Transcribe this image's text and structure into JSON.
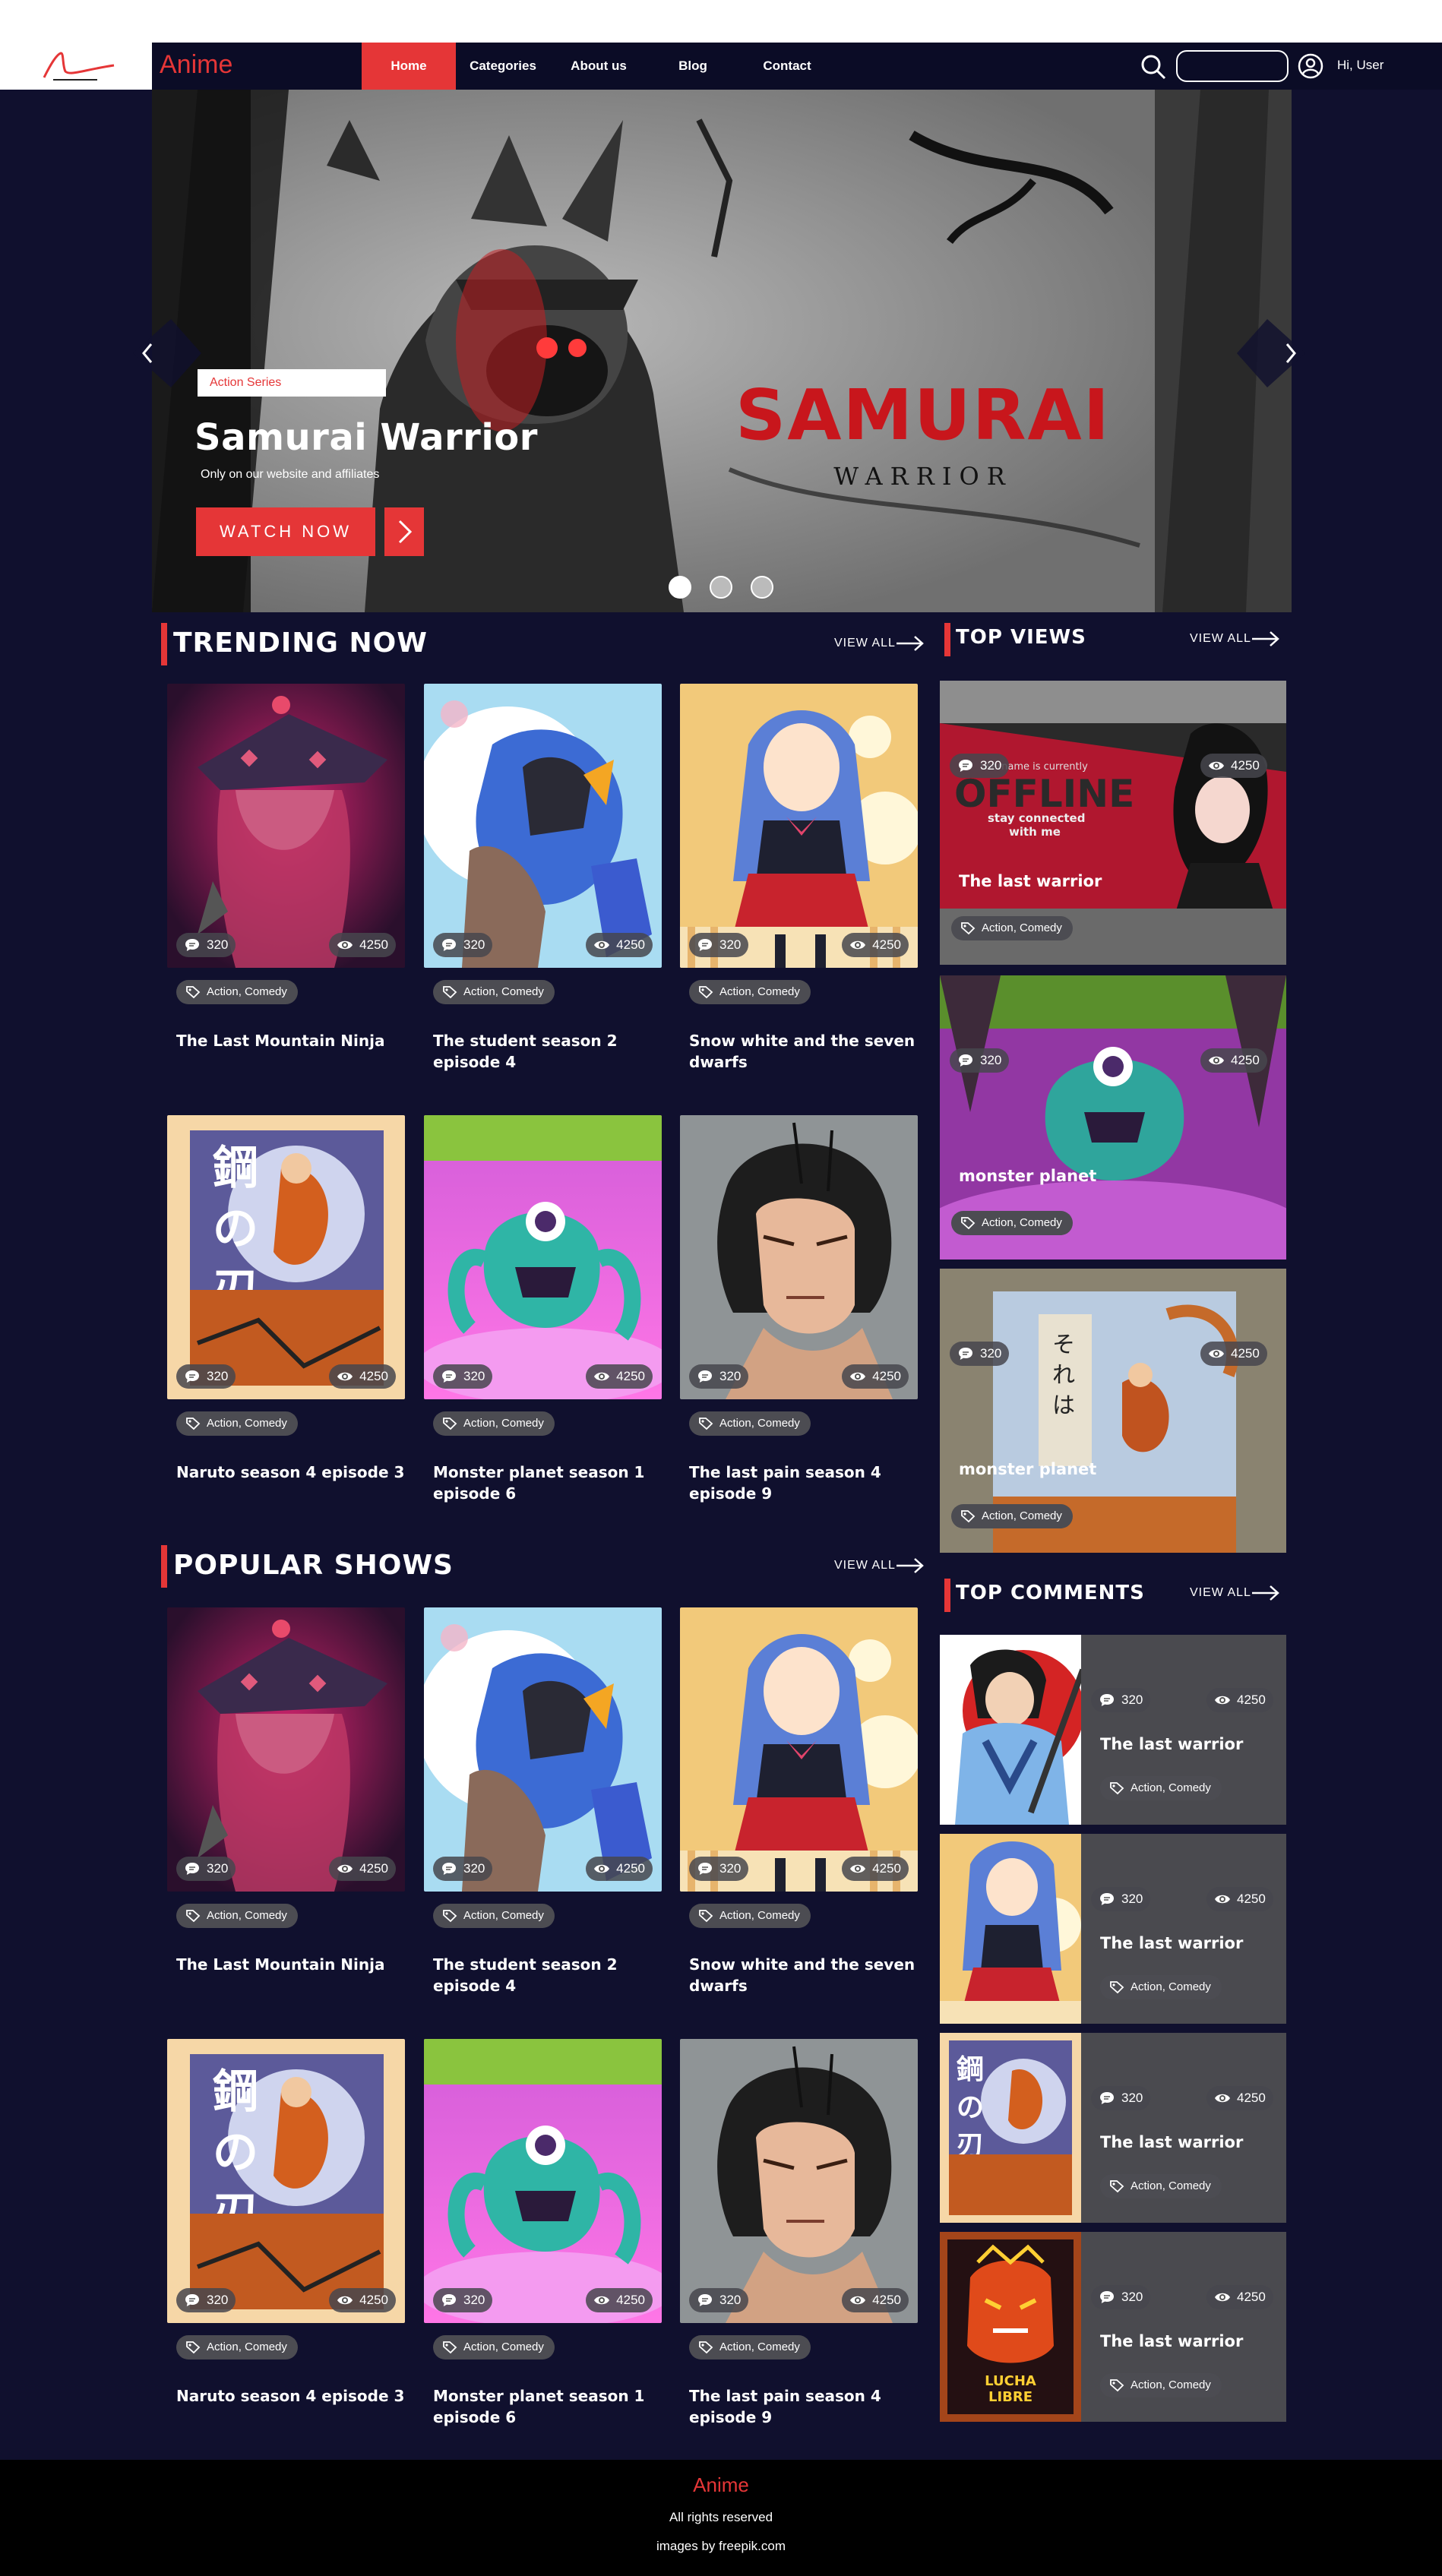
{
  "header": {
    "brand": "Anime",
    "nav": [
      {
        "label": "Home"
      },
      {
        "label": "Categories"
      },
      {
        "label": "About us"
      },
      {
        "label": "Blog"
      },
      {
        "label": "Contact"
      }
    ],
    "search_placeholder": "",
    "user_greeting": "Hi, User"
  },
  "hero": {
    "label": "Action Series",
    "title": "Samurai Warrior",
    "subtitle": "Only on our website and affiliates",
    "watch_button": "WATCH NOW",
    "art_title": "SAMURAI",
    "art_subtitle": "WARRIOR",
    "slide_count": 3,
    "active_slide": 1
  },
  "trending": {
    "title": "TRENDING NOW",
    "view_all": "VIEW ALL",
    "cards": [
      {
        "comments": "320",
        "views": "4250",
        "tags": "Action, Comedy",
        "title": "The Last Mountain Ninja"
      },
      {
        "comments": "320",
        "views": "4250",
        "tags": "Action, Comedy",
        "title": "The student season 2 episode 4"
      },
      {
        "comments": "320",
        "views": "4250",
        "tags": "Action, Comedy",
        "title": "Snow white and the seven dwarfs"
      },
      {
        "comments": "320",
        "views": "4250",
        "tags": "Action, Comedy",
        "title": "Naruto season 4 episode 3"
      },
      {
        "comments": "320",
        "views": "4250",
        "tags": "Action, Comedy",
        "title": "Monster planet season 1 episode 6"
      },
      {
        "comments": "320",
        "views": "4250",
        "tags": "Action, Comedy",
        "title": "The last pain season 4 episode 9"
      }
    ]
  },
  "popular": {
    "title": "POPULAR SHOWS",
    "view_all": "VIEW ALL",
    "cards": [
      {
        "comments": "320",
        "views": "4250",
        "tags": "Action, Comedy",
        "title": "The Last Mountain Ninja"
      },
      {
        "comments": "320",
        "views": "4250",
        "tags": "Action, Comedy",
        "title": "The student season 2 episode 4"
      },
      {
        "comments": "320",
        "views": "4250",
        "tags": "Action, Comedy",
        "title": "Snow white and the seven dwarfs"
      },
      {
        "comments": "320",
        "views": "4250",
        "tags": "Action, Comedy",
        "title": "Naruto season 4 episode 3"
      },
      {
        "comments": "320",
        "views": "4250",
        "tags": "Action, Comedy",
        "title": "Monster planet season 1 episode 6"
      },
      {
        "comments": "320",
        "views": "4250",
        "tags": "Action, Comedy",
        "title": "The last pain season 4 episode 9"
      }
    ]
  },
  "top_views": {
    "title": "TOP VIEWS",
    "view_all": "VIEW ALL",
    "items": [
      {
        "comments": "320",
        "views": "4250",
        "name": "The last warrior",
        "tags": "Action, Comedy",
        "art_text": "OFFLINE",
        "art_small_1": "username is currently",
        "art_small_2": "stay connected",
        "art_small_3": "with me"
      },
      {
        "comments": "320",
        "views": "4250",
        "name": "monster planet",
        "tags": "Action, Comedy"
      },
      {
        "comments": "320",
        "views": "4250",
        "name": "monster planet",
        "tags": "Action, Comedy"
      }
    ]
  },
  "top_comments": {
    "title": "TOP COMMENTS",
    "view_all": "VIEW ALL",
    "items": [
      {
        "comments": "320",
        "views": "4250",
        "name": "The last warrior",
        "tags": "Action, Comedy"
      },
      {
        "comments": "320",
        "views": "4250",
        "name": "The last warrior",
        "tags": "Action, Comedy"
      },
      {
        "comments": "320",
        "views": "4250",
        "name": "The last warrior",
        "tags": "Action, Comedy"
      },
      {
        "comments": "320",
        "views": "4250",
        "name": "The last warrior",
        "tags": "Action, Comedy",
        "poster_text": "LUCHA LIBRE"
      }
    ]
  },
  "footer": {
    "brand": "Anime",
    "rights": "All rights reserved",
    "credit": "images by freepik.com"
  },
  "colors": {
    "accent": "#e53637",
    "background": "#10102e",
    "header": "#0b0c26",
    "card_panel": "#4a4a4f"
  }
}
